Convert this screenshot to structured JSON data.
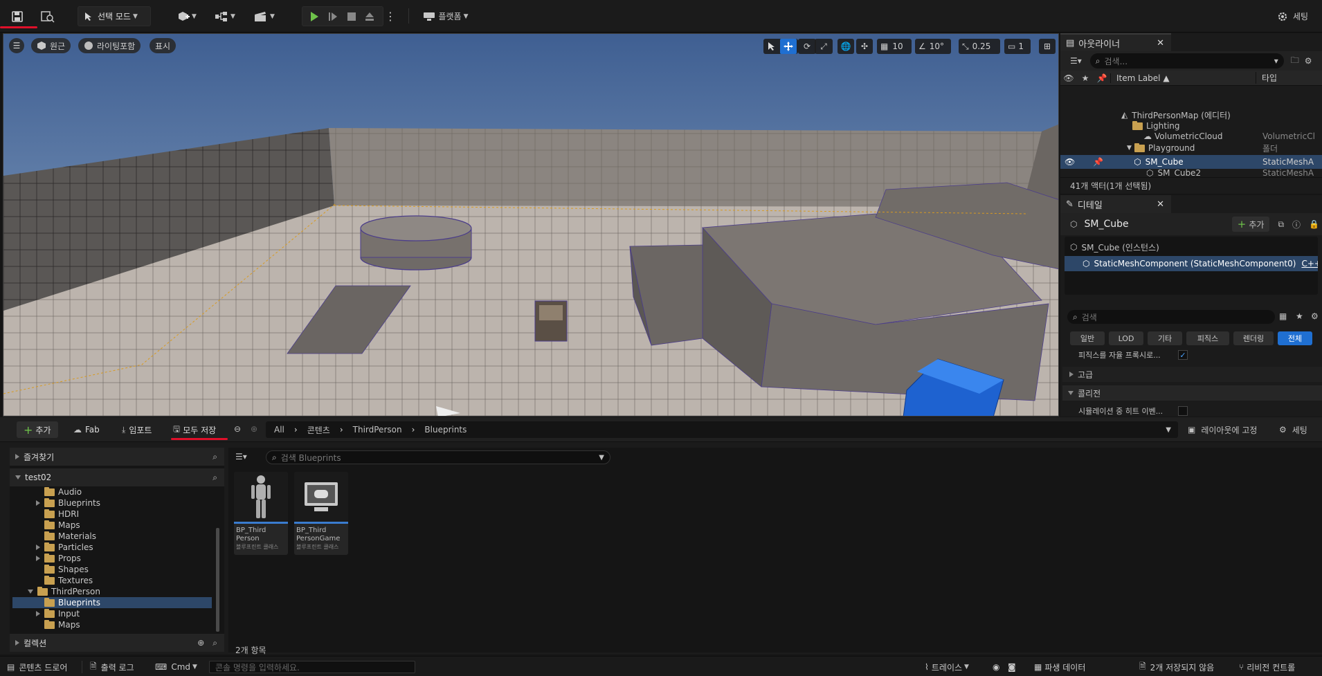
{
  "toolbar": {
    "mode_label": "선택 모드",
    "platforms_label": "플랫폼",
    "settings_label": "세팅"
  },
  "viewport": {
    "perspective_label": "원근",
    "lighting_label": "라이팅포함",
    "show_label": "표시",
    "grid_snap": "10",
    "rot_snap": "10°",
    "scale_snap": "0.25",
    "camera_speed": "1"
  },
  "outliner": {
    "tab_title": "아웃라이너",
    "search_placeholder": "검색...",
    "col_label": "Item Label ▲",
    "col_type": "타입",
    "rows": [
      {
        "label": "ThirdPersonMap (에디터)",
        "type": ""
      },
      {
        "label": "Lighting",
        "type": ""
      },
      {
        "label": "VolumetricCloud",
        "type": "VolumetricCl"
      },
      {
        "label": "Playground",
        "type": "폴더"
      },
      {
        "label": "SM_Cube",
        "type": "StaticMeshA"
      },
      {
        "label": "SM_Cube2",
        "type": "StaticMeshA"
      }
    ],
    "footer": "41개 액터(1개 선택됨)"
  },
  "details": {
    "tab_title": "디테일",
    "object_name": "SM_Cube",
    "add_label": "추가",
    "instance_label": "SM_Cube (인스턴스)",
    "component_label": "StaticMeshComponent (StaticMeshComponent0)",
    "component_link": "C++C",
    "search_placeholder": "검색",
    "filters": [
      "일반",
      "LOD",
      "기타",
      "피직스",
      "렌더링",
      "전체"
    ],
    "prop1": "피직스를 자율 프록시로...",
    "section_advanced": "고급",
    "section_collision": "콜리전",
    "prop2": "시뮬레이션 중 히트 이벤..."
  },
  "content_browser": {
    "add_label": "추가",
    "fab_label": "Fab",
    "import_label": "임포트",
    "save_all_label": "모두 저장",
    "breadcrumb": [
      "All",
      "콘텐츠",
      "ThirdPerson",
      "Blueprints"
    ],
    "lock_layout_label": "레이아웃에 고정",
    "settings_label": "세팅",
    "favorites_label": "즐겨찾기",
    "project_label": "test02",
    "tree": [
      "Audio",
      "Blueprints",
      "HDRI",
      "Maps",
      "Materials",
      "Particles",
      "Props",
      "Shapes",
      "Textures",
      "ThirdPerson",
      "Blueprints",
      "Input",
      "Maps"
    ],
    "collections_label": "컬렉션",
    "search_placeholder": "검색 Blueprints",
    "assets": [
      {
        "name1": "BP_Third",
        "name2": "Person",
        "type": "블루프린트 클래스"
      },
      {
        "name1": "BP_Third",
        "name2": "PersonGame",
        "type": "블루프린트 클래스"
      }
    ],
    "item_count": "2개 항목"
  },
  "statusbar": {
    "content_drawer": "콘텐츠 드로어",
    "output_log": "출력 로그",
    "cmd": "Cmd",
    "console_placeholder": "콘솔 명령을 입력하세요.",
    "trace": "트레이스",
    "derived_data": "파생 데이터",
    "unsaved": "2개 저장되지 않음",
    "revision": "리비전 컨트롤"
  }
}
